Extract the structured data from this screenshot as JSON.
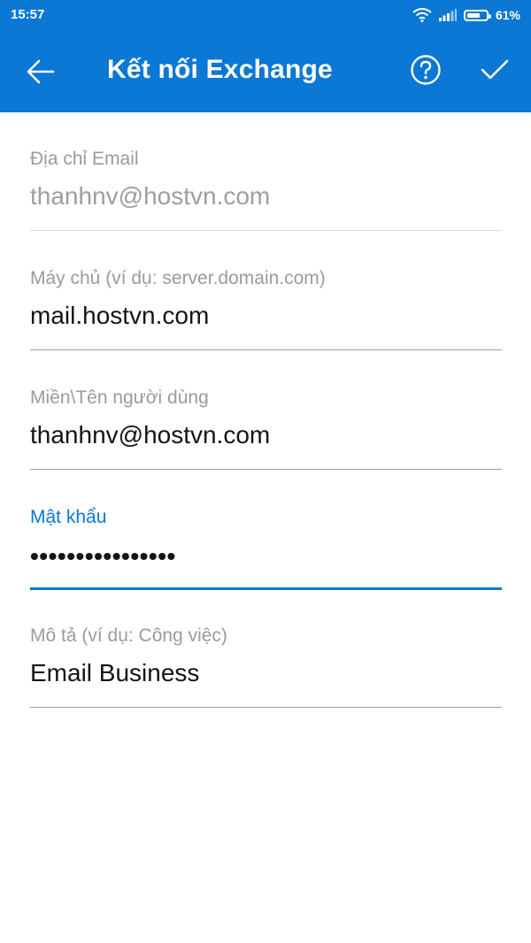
{
  "status_bar": {
    "time": "15:57",
    "battery_percent": "61%",
    "battery_level": 0.61,
    "icons": [
      "wifi-icon",
      "signal-icon",
      "battery-icon"
    ]
  },
  "app_bar": {
    "title": "Kết nối Exchange",
    "color": "#0a78d4",
    "icons": [
      "back-arrow-icon",
      "help-icon",
      "checkmark-icon"
    ]
  },
  "form": {
    "email": {
      "label": "Địa chỉ Email",
      "value": "thanhnv@hostvn.com"
    },
    "server": {
      "label": "Máy chủ (ví dụ: server.domain.com)",
      "value": "mail.hostvn.com"
    },
    "username": {
      "label": "Miền\\Tên người dùng",
      "value": "thanhnv@hostvn.com"
    },
    "password": {
      "label": "Mật khẩu",
      "value": "••••••••••••••••"
    },
    "description": {
      "label": "Mô tả (ví dụ: Công việc)",
      "value": "Email Business"
    }
  }
}
